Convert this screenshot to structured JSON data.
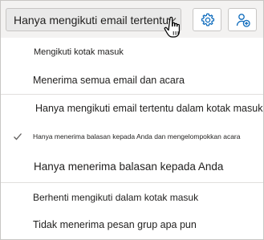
{
  "toolbar": {
    "dropdown_value": "Hanya mengikuti email tertentu",
    "settings_icon": "gear-icon",
    "add_follower_icon": "person-add-icon"
  },
  "menu": {
    "items": [
      {
        "label": "Mengikuti kotak masuk",
        "selected": false
      },
      {
        "label": "Menerima semua email dan acara",
        "selected": false
      },
      {
        "label": "Hanya mengikuti email tertentu dalam kotak masuk",
        "selected": false
      },
      {
        "label": "Hanya menerima balasan kepada Anda dan mengelompokkan acara",
        "selected": true
      },
      {
        "label": "Hanya menerima balasan kepada Anda",
        "selected": false
      },
      {
        "label": "Berhenti mengikuti dalam kotak masuk",
        "selected": false
      },
      {
        "label": "Tidak menerima pesan grup apa pun",
        "selected": false
      }
    ]
  },
  "colors": {
    "accent": "#0f6cbd",
    "text": "#201f1e",
    "border": "#c8c6c4"
  }
}
